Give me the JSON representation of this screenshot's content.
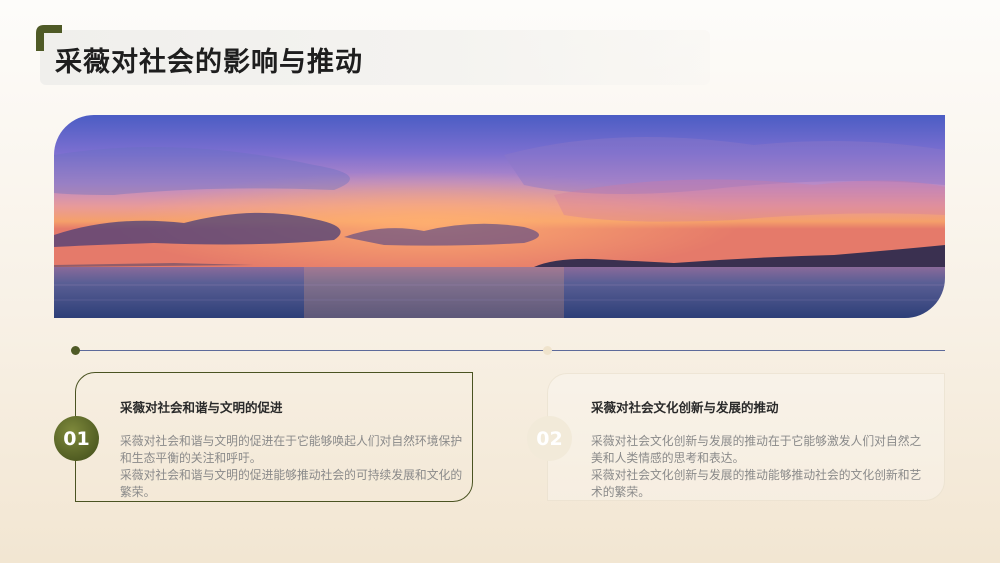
{
  "title": "采薇对社会的影响与推动",
  "colors": {
    "accent": "#4f5a26",
    "timeline": "#5d6a9a",
    "badge_light": "#f2ead9"
  },
  "cards": [
    {
      "number": "01",
      "heading": "采薇对社会和谐与文明的促进",
      "paragraph1": "采薇对社会和谐与文明的促进在于它能够唤起人们对自然环境保护和生态平衡的关注和呼吁。",
      "paragraph2": "采薇对社会和谐与文明的促进能够推动社会的可持续发展和文化的繁荣。"
    },
    {
      "number": "02",
      "heading": "采薇对社会文化创新与发展的推动",
      "paragraph1": "采薇对社会文化创新与发展的推动在于它能够激发人们对自然之美和人类情感的思考和表达。",
      "paragraph2": "采薇对社会文化创新与发展的推动能够推动社会的文化创新和艺术的繁荣。"
    }
  ]
}
